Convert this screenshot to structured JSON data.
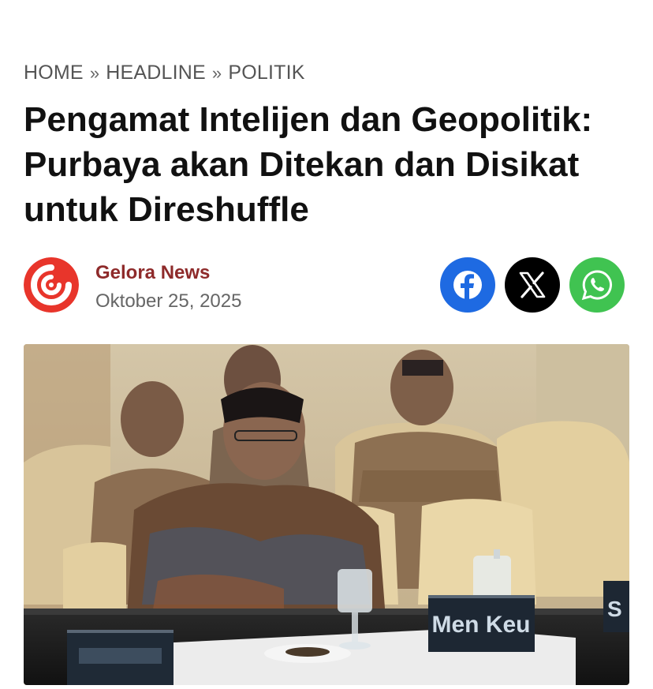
{
  "breadcrumb": {
    "items": [
      "HOME",
      "HEADLINE",
      "POLITIK"
    ],
    "separator": "»"
  },
  "article": {
    "title": "Pengamat Intelijen dan Geopolitik: Purbaya akan Ditekan dan Disikat untuk Direshuffle",
    "author": "Gelora News",
    "date": "Oktober 25, 2025"
  },
  "share": {
    "buttons": [
      {
        "name": "facebook",
        "icon": "facebook-icon",
        "color": "#1e6ae2"
      },
      {
        "name": "x",
        "icon": "x-icon",
        "color": "#000000"
      },
      {
        "name": "whatsapp",
        "icon": "whatsapp-icon",
        "color": "#40c351"
      }
    ]
  },
  "photo": {
    "name_plates": [
      "Men Keu",
      "S"
    ]
  },
  "colors": {
    "author": "#8e2a2a",
    "brand_logo": "#e8352b"
  }
}
